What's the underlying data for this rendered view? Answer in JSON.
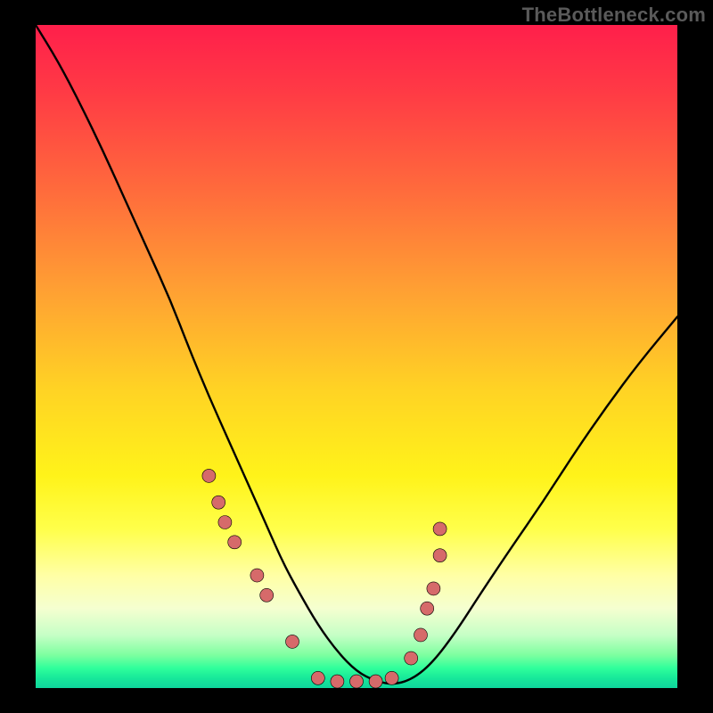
{
  "watermark": "TheBottleneck.com",
  "chart_data": {
    "type": "line",
    "title": "",
    "xlabel": "",
    "ylabel": "",
    "xlim": [
      0,
      100
    ],
    "ylim": [
      0,
      100
    ],
    "grid": false,
    "background": "red-yellow-green vertical gradient (bottleneck heatmap)",
    "series": [
      {
        "name": "bottleneck-curve",
        "color": "#000000",
        "x": [
          0,
          3.5,
          7,
          10.5,
          14,
          17.5,
          21,
          24,
          27,
          30,
          33,
          36,
          38.5,
          41,
          44,
          47,
          50,
          53,
          56,
          59,
          62,
          65.5,
          69.5,
          74,
          79,
          84,
          89,
          94,
          100
        ],
        "y": [
          100,
          94.5,
          88,
          81,
          73.5,
          66,
          58.5,
          51,
          44,
          37.5,
          31,
          24.5,
          19,
          14.5,
          9.5,
          5.5,
          2.5,
          1,
          0.5,
          1.5,
          4,
          8.5,
          14.5,
          21,
          28,
          35.5,
          42.5,
          49,
          56
        ]
      },
      {
        "name": "marker-dots",
        "type": "scatter",
        "color": "#d66a6a",
        "x": [
          27,
          28.5,
          29.5,
          31,
          34.5,
          36,
          40,
          44,
          47,
          50,
          53,
          55.5,
          58.5,
          60,
          61,
          62,
          63,
          63
        ],
        "y": [
          32,
          28,
          25,
          22,
          17,
          14,
          7,
          1.5,
          1,
          1,
          1,
          1.5,
          4.5,
          8,
          12,
          15,
          20,
          24
        ]
      }
    ],
    "annotations": []
  },
  "colors": {
    "curve": "#000000",
    "marker": "#d66a6a",
    "frame": "#000000",
    "watermark": "#5a5a5a"
  }
}
